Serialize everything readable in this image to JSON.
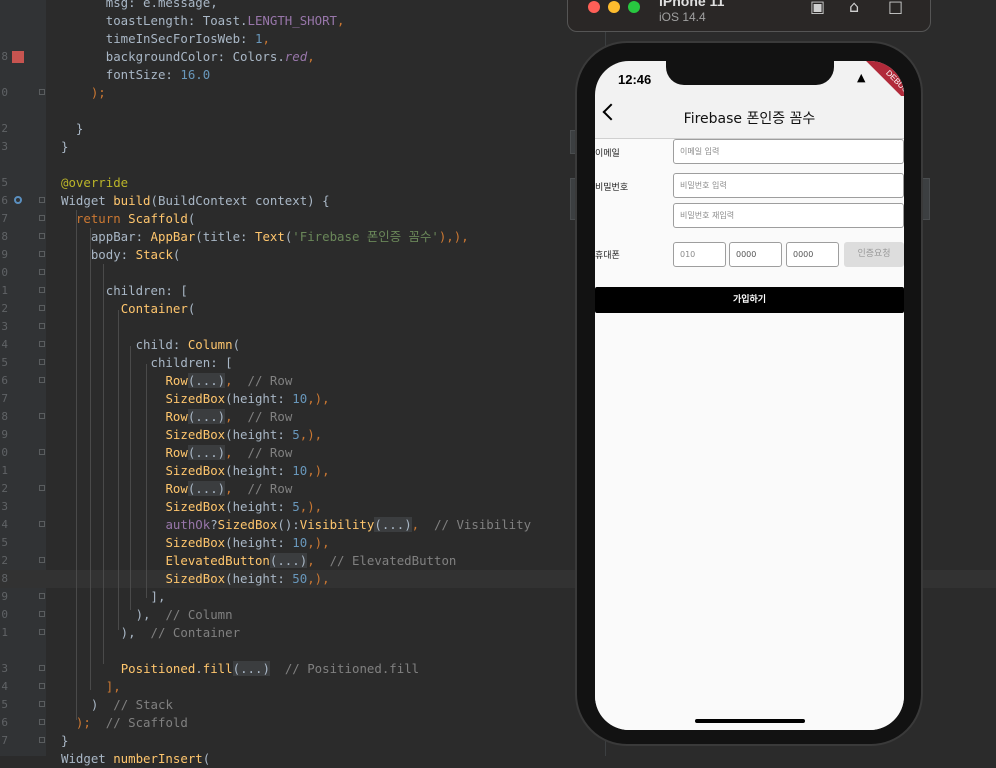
{
  "editor": {
    "lines": [
      {
        "n": "",
        "seg": [
          [
            "      msg: e.message,",
            "pl"
          ]
        ]
      },
      {
        "n": "",
        "seg": [
          [
            "      toastLength: Toast.",
            "pl"
          ],
          [
            "LENGTH_SHORT",
            "prop"
          ],
          [
            ",",
            "kw"
          ]
        ]
      },
      {
        "n": "",
        "seg": [
          [
            "      timeInSecForIosWeb: ",
            "pl"
          ],
          [
            "1",
            "num"
          ],
          [
            ",",
            "kw"
          ]
        ]
      },
      {
        "n": "8",
        "seg": [
          [
            "      backgroundColor: Colors.",
            "pl"
          ],
          [
            "red",
            "itl"
          ],
          [
            ",",
            "kw"
          ]
        ]
      },
      {
        "n": "",
        "seg": [
          [
            "      fontSize: ",
            "pl"
          ],
          [
            "16.0",
            "num"
          ]
        ]
      },
      {
        "n": "0",
        "seg": [
          [
            "    );",
            "kw"
          ]
        ]
      },
      {
        "n": "",
        "seg": [
          [
            "",
            "pl"
          ]
        ]
      },
      {
        "n": "2",
        "seg": [
          [
            "  }",
            "pl"
          ]
        ]
      },
      {
        "n": "3",
        "seg": [
          [
            "}",
            "pl"
          ]
        ]
      },
      {
        "n": "",
        "seg": [
          [
            "",
            "pl"
          ]
        ]
      },
      {
        "n": "5",
        "seg": [
          [
            "@override",
            "ann"
          ]
        ]
      },
      {
        "n": "6",
        "seg": [
          [
            "Widget ",
            "pl"
          ],
          [
            "build",
            "cls"
          ],
          [
            "(BuildContext context) {",
            "pl"
          ]
        ]
      },
      {
        "n": "7",
        "seg": [
          [
            "  ",
            "pl"
          ],
          [
            "return ",
            "kw"
          ],
          [
            "Scaffold",
            "cls"
          ],
          [
            "(",
            "pl"
          ]
        ]
      },
      {
        "n": "8",
        "seg": [
          [
            "    appBar: ",
            "pl"
          ],
          [
            "AppBar",
            "cls"
          ],
          [
            "(title: ",
            "pl"
          ],
          [
            "Text",
            "cls"
          ],
          [
            "(",
            "pl"
          ],
          [
            "'Firebase 폰인증 꼼수'",
            "str"
          ],
          [
            "),",
            "kw"
          ],
          [
            "),",
            "kw"
          ]
        ]
      },
      {
        "n": "9",
        "seg": [
          [
            "    body: ",
            "pl"
          ],
          [
            "Stack",
            "cls"
          ],
          [
            "(",
            "pl"
          ]
        ]
      },
      {
        "n": "0",
        "seg": [
          [
            "",
            "pl"
          ]
        ]
      },
      {
        "n": "1",
        "seg": [
          [
            "      children: [",
            "pl"
          ]
        ]
      },
      {
        "n": "2",
        "seg": [
          [
            "        ",
            "pl"
          ],
          [
            "Container",
            "cls"
          ],
          [
            "(",
            "pl"
          ]
        ]
      },
      {
        "n": "3",
        "seg": [
          [
            "",
            "pl"
          ]
        ]
      },
      {
        "n": "4",
        "seg": [
          [
            "          child: ",
            "pl"
          ],
          [
            "Column",
            "cls"
          ],
          [
            "(",
            "pl"
          ]
        ]
      },
      {
        "n": "5",
        "seg": [
          [
            "            children: [",
            "pl"
          ]
        ]
      },
      {
        "n": "6",
        "seg": [
          [
            "              ",
            "pl"
          ],
          [
            "Row",
            "cls"
          ],
          [
            "(...)",
            "fold"
          ],
          [
            ",  ",
            "kw"
          ],
          [
            "// Row",
            "cmt"
          ]
        ]
      },
      {
        "n": "7",
        "seg": [
          [
            "              ",
            "pl"
          ],
          [
            "SizedBox",
            "cls"
          ],
          [
            "(height: ",
            "pl"
          ],
          [
            "10",
            "num"
          ],
          [
            ",),",
            "kw"
          ]
        ]
      },
      {
        "n": "8",
        "seg": [
          [
            "              ",
            "pl"
          ],
          [
            "Row",
            "cls"
          ],
          [
            "(...)",
            "fold"
          ],
          [
            ",  ",
            "kw"
          ],
          [
            "// Row",
            "cmt"
          ]
        ]
      },
      {
        "n": "9",
        "seg": [
          [
            "              ",
            "pl"
          ],
          [
            "SizedBox",
            "cls"
          ],
          [
            "(height: ",
            "pl"
          ],
          [
            "5",
            "num"
          ],
          [
            ",),",
            "kw"
          ]
        ]
      },
      {
        "n": "0",
        "seg": [
          [
            "              ",
            "pl"
          ],
          [
            "Row",
            "cls"
          ],
          [
            "(...)",
            "fold"
          ],
          [
            ",  ",
            "kw"
          ],
          [
            "// Row",
            "cmt"
          ]
        ]
      },
      {
        "n": "1",
        "seg": [
          [
            "              ",
            "pl"
          ],
          [
            "SizedBox",
            "cls"
          ],
          [
            "(height: ",
            "pl"
          ],
          [
            "10",
            "num"
          ],
          [
            ",),",
            "kw"
          ]
        ]
      },
      {
        "n": "2",
        "seg": [
          [
            "              ",
            "pl"
          ],
          [
            "Row",
            "cls"
          ],
          [
            "(...)",
            "fold"
          ],
          [
            ",  ",
            "kw"
          ],
          [
            "// Row",
            "cmt"
          ]
        ]
      },
      {
        "n": "3",
        "seg": [
          [
            "              ",
            "pl"
          ],
          [
            "SizedBox",
            "cls"
          ],
          [
            "(height: ",
            "pl"
          ],
          [
            "5",
            "num"
          ],
          [
            ",),",
            "kw"
          ]
        ]
      },
      {
        "n": "4",
        "seg": [
          [
            "              ",
            "pl"
          ],
          [
            "authOk",
            "prop"
          ],
          [
            "?",
            "pl"
          ],
          [
            "SizedBox",
            "cls"
          ],
          [
            "():",
            "pl"
          ],
          [
            "Visibility",
            "cls"
          ],
          [
            "(...)",
            "fold"
          ],
          [
            ",  ",
            "kw"
          ],
          [
            "// Visibility",
            "cmt"
          ]
        ]
      },
      {
        "n": "5",
        "seg": [
          [
            "              ",
            "pl"
          ],
          [
            "SizedBox",
            "cls"
          ],
          [
            "(height: ",
            "pl"
          ],
          [
            "10",
            "num"
          ],
          [
            ",),",
            "kw"
          ]
        ]
      },
      {
        "n": "2",
        "seg": [
          [
            "              ",
            "pl"
          ],
          [
            "ElevatedButton",
            "cls"
          ],
          [
            "(...)",
            "fold"
          ],
          [
            ",  ",
            "kw"
          ],
          [
            "// ElevatedButton",
            "cmt"
          ]
        ]
      },
      {
        "n": "8",
        "seg": [
          [
            "              ",
            "pl"
          ],
          [
            "SizedBox",
            "cls"
          ],
          [
            "(height: ",
            "pl"
          ],
          [
            "50",
            "num"
          ],
          [
            ",),",
            "kw"
          ]
        ]
      },
      {
        "n": "9",
        "seg": [
          [
            "            ],",
            "pl"
          ]
        ]
      },
      {
        "n": "0",
        "seg": [
          [
            "          ),",
            "pl"
          ],
          [
            "  // Column",
            "cmt"
          ]
        ]
      },
      {
        "n": "1",
        "seg": [
          [
            "        ),",
            "pl"
          ],
          [
            "  // Container",
            "cmt"
          ]
        ]
      },
      {
        "n": "",
        "seg": [
          [
            "",
            "pl"
          ]
        ]
      },
      {
        "n": "3",
        "seg": [
          [
            "        ",
            "pl"
          ],
          [
            "Positioned",
            "cls"
          ],
          [
            ".",
            "pl"
          ],
          [
            "fill",
            "cls"
          ],
          [
            "(...)",
            "fold"
          ],
          [
            "  // Positioned.fill",
            "cmt"
          ]
        ]
      },
      {
        "n": "4",
        "seg": [
          [
            "      ],",
            "kw"
          ]
        ]
      },
      {
        "n": "5",
        "seg": [
          [
            "    )",
            "pl"
          ],
          [
            "  // Stack",
            "cmt"
          ]
        ]
      },
      {
        "n": "6",
        "seg": [
          [
            "  );",
            "kw"
          ],
          [
            "  // Scaffold",
            "cmt"
          ]
        ]
      },
      {
        "n": "7",
        "seg": [
          [
            "}",
            "pl"
          ]
        ]
      },
      {
        "n": "",
        "seg": [
          [
            "Widget ",
            "pl"
          ],
          [
            "numberInsert",
            "cls"
          ],
          [
            "(",
            "pl"
          ]
        ]
      }
    ]
  },
  "simulator": {
    "device": "iPhone 11",
    "os": "iOS 14.4"
  },
  "phone": {
    "time": "12:46",
    "debug_banner": "DEBUG",
    "appbar_title": "Firebase 폰인증 꼼수",
    "email_label": "이메일",
    "email_placeholder": "이메일 입력",
    "password_label": "비밀번호",
    "password_placeholder": "비밀번호 입력",
    "password_confirm_placeholder": "비밀번호 재입력",
    "phone_label": "휴대폰",
    "phone_part1": "010",
    "phone_part2": "0000",
    "phone_part3": "0000",
    "request_auth_button": "인증요청",
    "signup_button": "가입하기"
  }
}
